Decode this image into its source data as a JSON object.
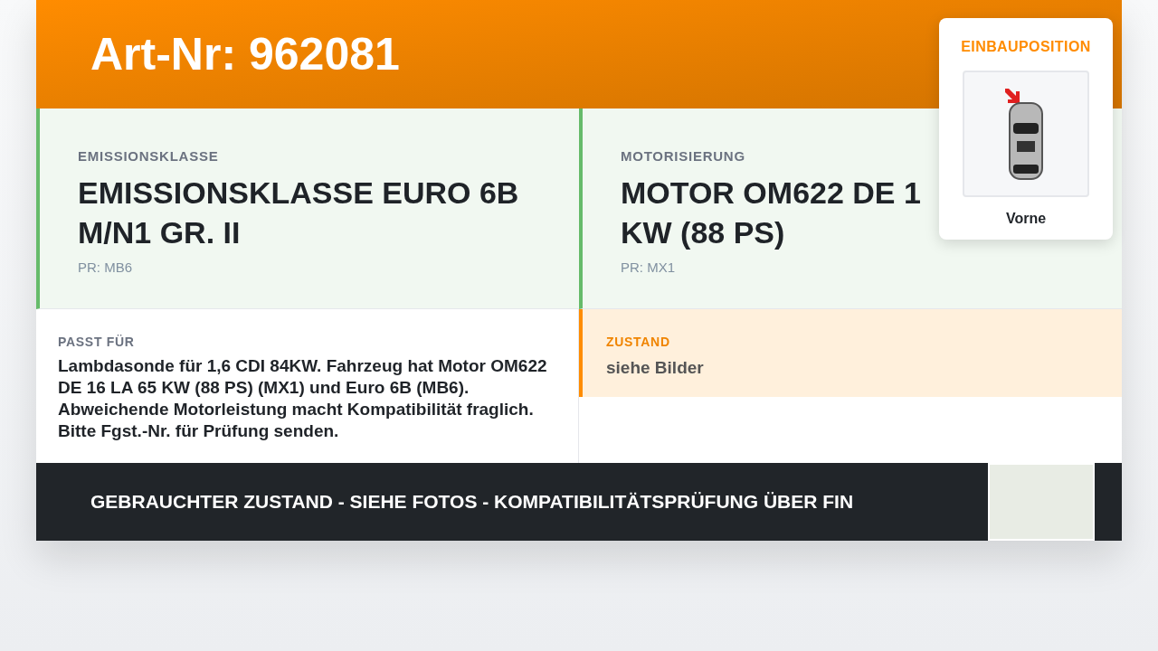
{
  "header": {
    "title": "Art-Nr: 962081"
  },
  "specs": [
    {
      "label": "EMISSIONSKLASSE",
      "value": "EMISSIONSKLASSE EURO 6B M/N1 GR. II",
      "code": "PR: MB6"
    },
    {
      "label": "MOTORISIERUNG",
      "value": "MOTOR OM622 DE 1 KW (88 PS)",
      "code": "PR: MX1"
    }
  ],
  "fitment": {
    "label": "PASST FÜR",
    "text": "Lambdasonde für 1,6 CDI 84KW. Fahrzeug hat Motor OM622 DE 16 LA 65 KW (88 PS) (MX1) und Euro 6B (MB6). Abweichende Motorleistung macht Kompatibilität fraglich. Bitte Fgst.-Nr. für Prüfung senden."
  },
  "condition": {
    "label": "ZUSTAND",
    "text": "siehe Bilder"
  },
  "position": {
    "label": "EINBAUPOSITION",
    "value": "Vorne"
  },
  "footer": {
    "text": "GEBRAUCHTER ZUSTAND - SIEHE FOTOS - KOMPATIBILITÄTSPRÜFUNG ÜBER FIN"
  }
}
